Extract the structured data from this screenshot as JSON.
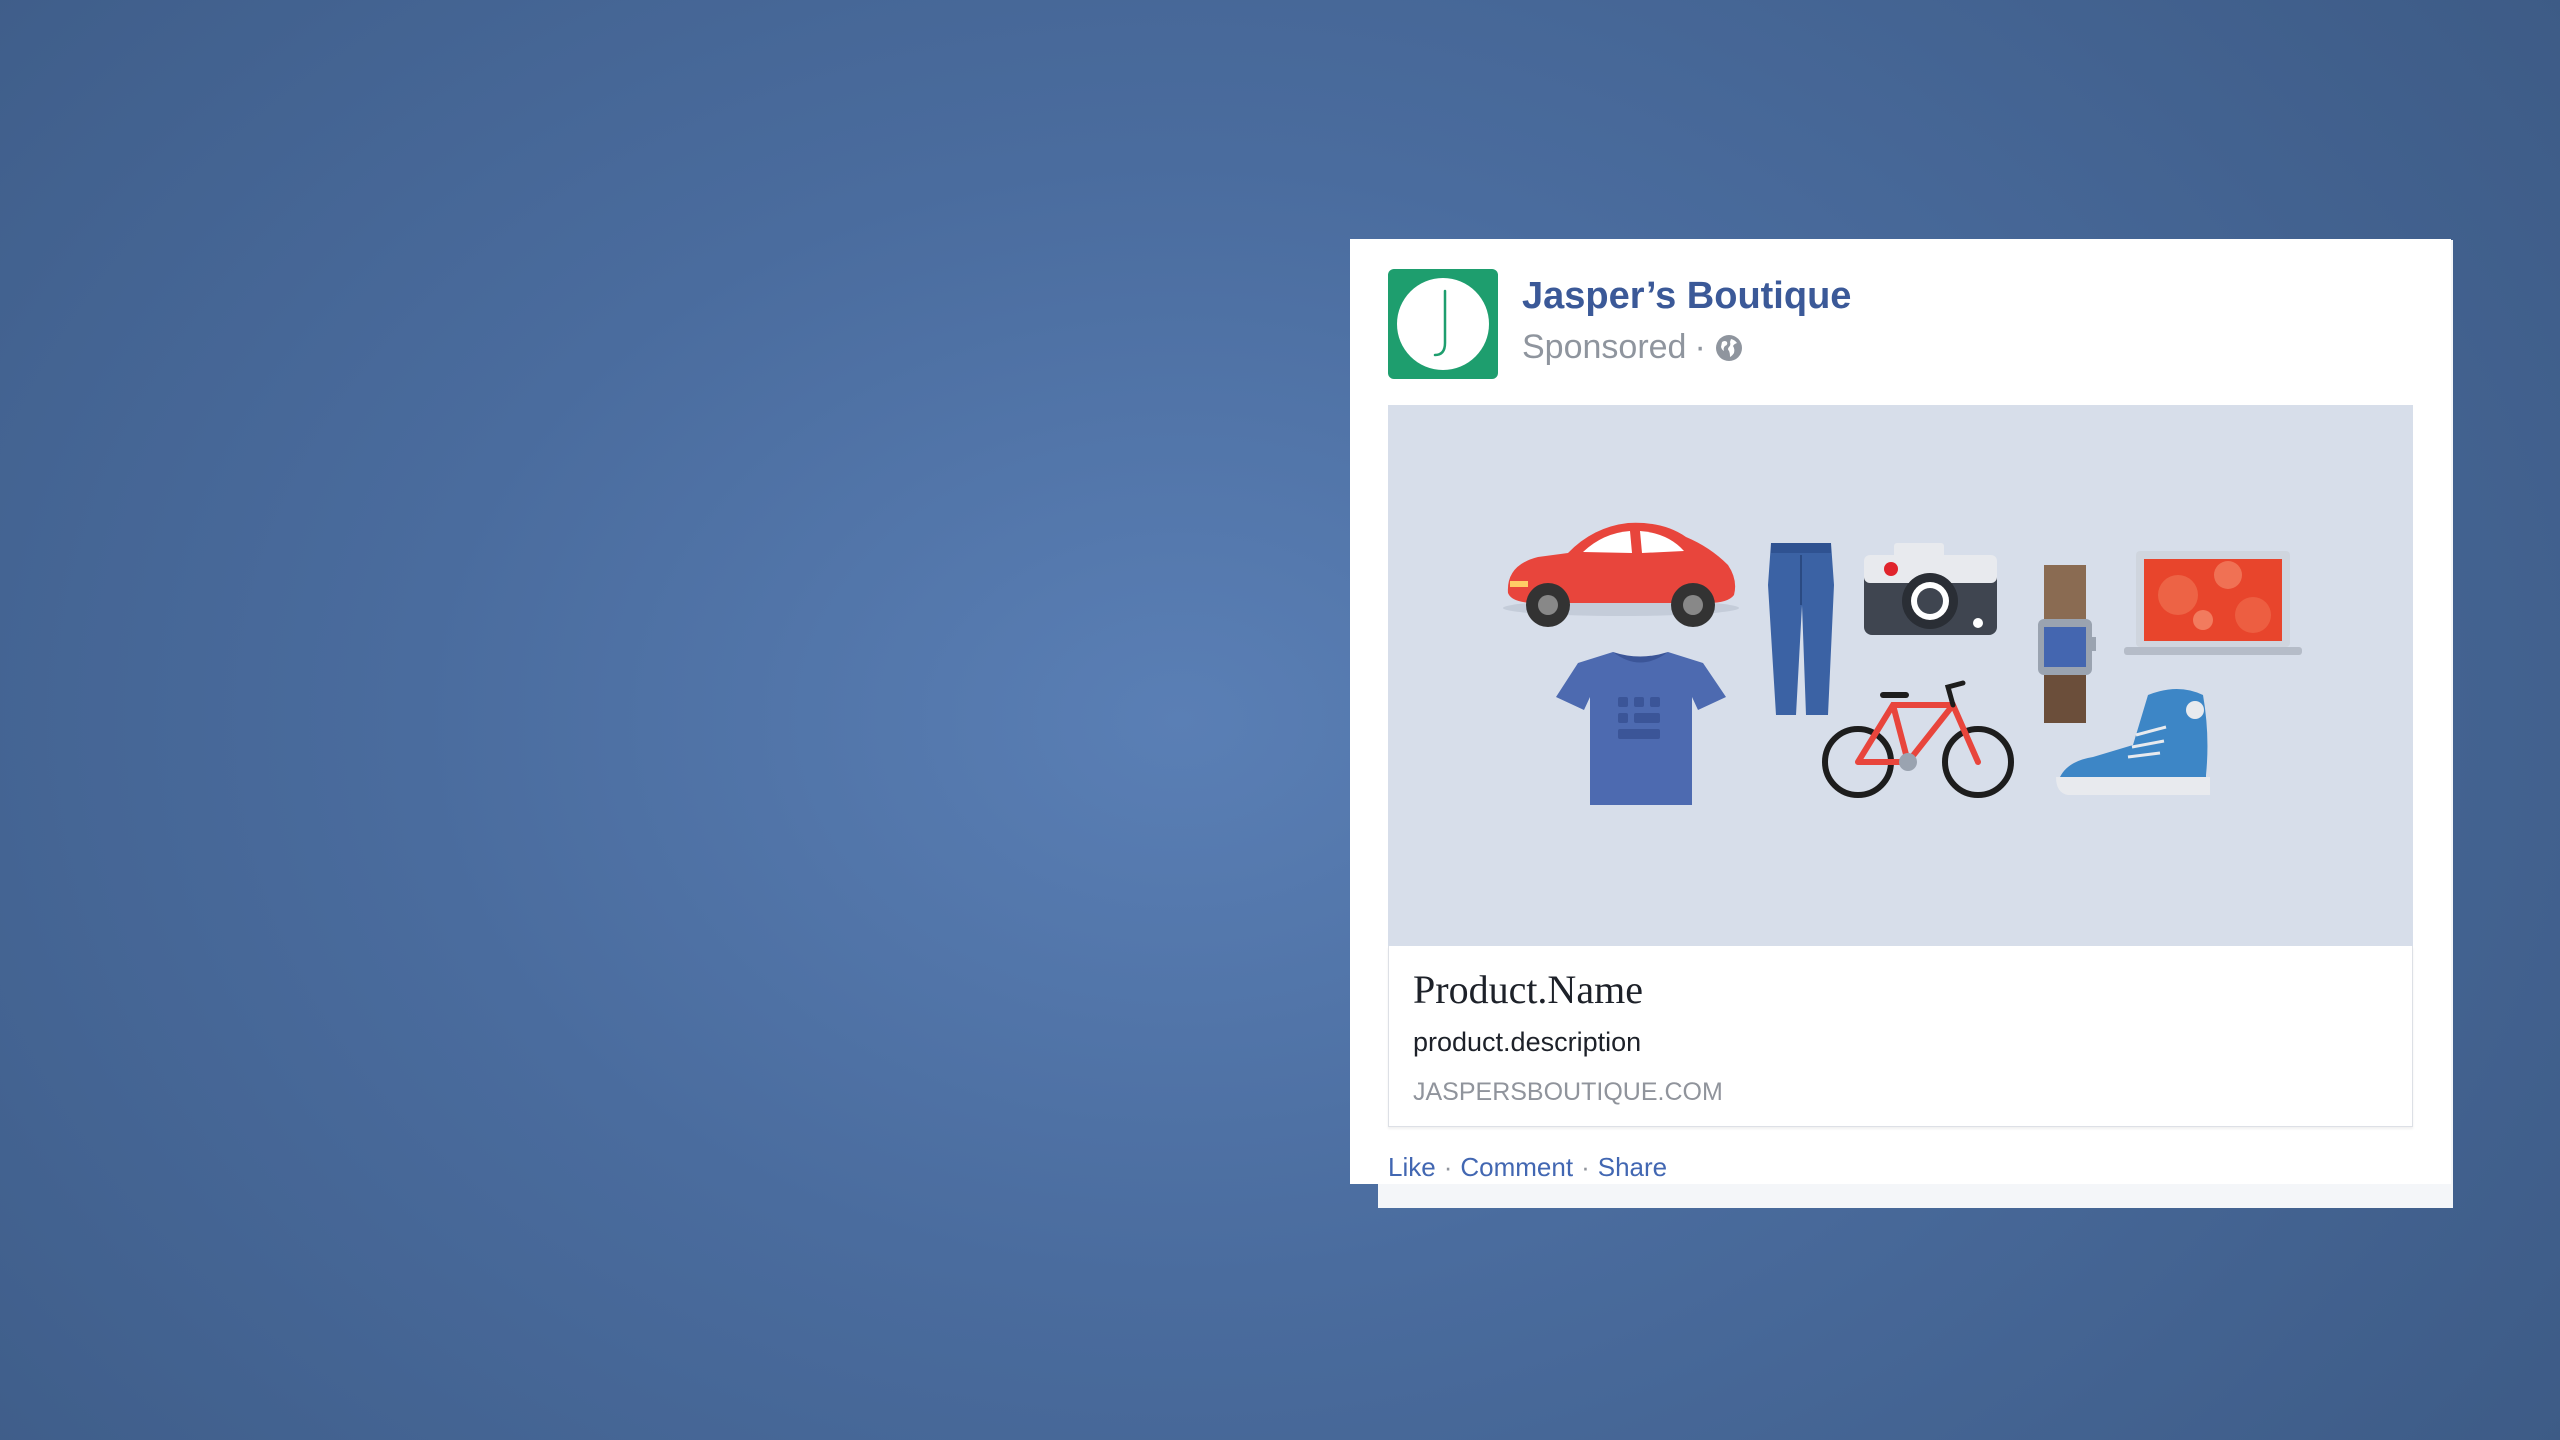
{
  "post": {
    "page_name": "Jasper’s Boutique",
    "sponsored_label": "Sponsored",
    "meta_separator": "·",
    "avatar_letter": "J",
    "privacy_icon": "globe-icon",
    "creative_items": [
      "car-icon",
      "jeans-icon",
      "camera-icon",
      "watch-icon",
      "laptop-icon",
      "tshirt-icon",
      "bicycle-icon",
      "sneaker-icon"
    ],
    "link": {
      "title": "Product.Name",
      "description": "product.description",
      "domain": "JASPERSBOUTIQUE.COM"
    },
    "actions": {
      "like": "Like",
      "comment": "Comment",
      "share": "Share",
      "separator": "·"
    }
  },
  "colors": {
    "background": "#4a6c9e",
    "brand_link": "#3b5998",
    "avatar_green": "#1e9e6e",
    "creative_bg": "#d7deea"
  }
}
